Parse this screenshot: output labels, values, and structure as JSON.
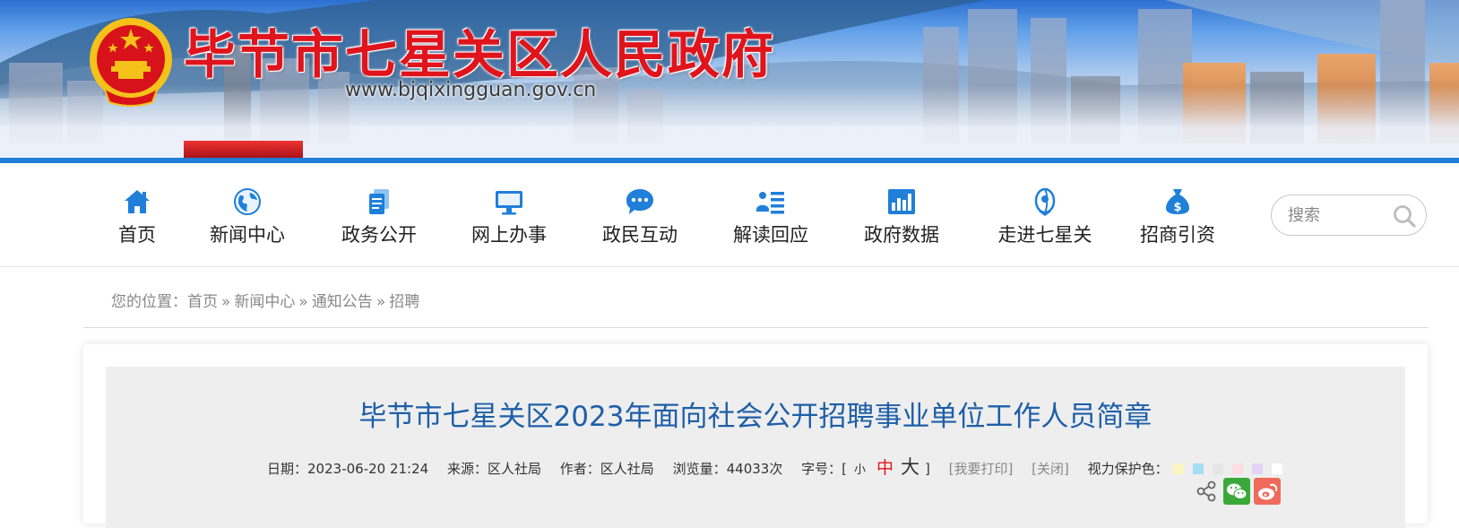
{
  "banner": {
    "site_title": "毕节市七星关区人民政府",
    "site_url": "www.bjqixingguan.gov.cn"
  },
  "nav": {
    "items": [
      {
        "label": "首页",
        "icon": "home-icon"
      },
      {
        "label": "新闻中心",
        "icon": "globe-icon"
      },
      {
        "label": "政务公开",
        "icon": "document-icon"
      },
      {
        "label": "网上办事",
        "icon": "monitor-icon"
      },
      {
        "label": "政民互动",
        "icon": "chat-bubble-icon"
      },
      {
        "label": "解读回应",
        "icon": "list-user-icon"
      },
      {
        "label": "政府数据",
        "icon": "bar-chart-icon"
      },
      {
        "label": "走进七星关",
        "icon": "location-icon"
      },
      {
        "label": "招商引资",
        "icon": "money-bag-icon"
      }
    ],
    "search": {
      "placeholder": "搜索"
    }
  },
  "breadcrumb": {
    "prefix": "您的位置：",
    "items": [
      "首页",
      "新闻中心",
      "通知公告",
      "招聘"
    ],
    "separator": "»"
  },
  "article": {
    "title": "毕节市七星关区2023年面向社会公开招聘事业单位工作人员简章",
    "meta": {
      "date_label": "日期：",
      "date": "2023-06-20 21:24",
      "source_label": "来源：",
      "source": "区人社局",
      "author_label": "作者：",
      "author": "区人社局",
      "views_label": "浏览量：",
      "views": "44033次",
      "fontsize_label": "字号：[",
      "fontsize_close": "]",
      "font_small": "小",
      "font_medium": "中",
      "font_large": "大",
      "print": "[我要打印]",
      "close": "[关闭]",
      "eye_care_label": "视力保护色："
    },
    "eye_care_colors": [
      "#fbf5c0",
      "#a5def5",
      "#e5e5e5",
      "#fbdde6",
      "#e5d4f7",
      "#ffffff"
    ],
    "share": [
      "share-icon",
      "wechat-icon",
      "weibo-icon"
    ]
  },
  "colors": {
    "title_red": "#e0141c",
    "article_title_blue": "#1e5fa8",
    "banner_strip": "#1f7fd9"
  }
}
